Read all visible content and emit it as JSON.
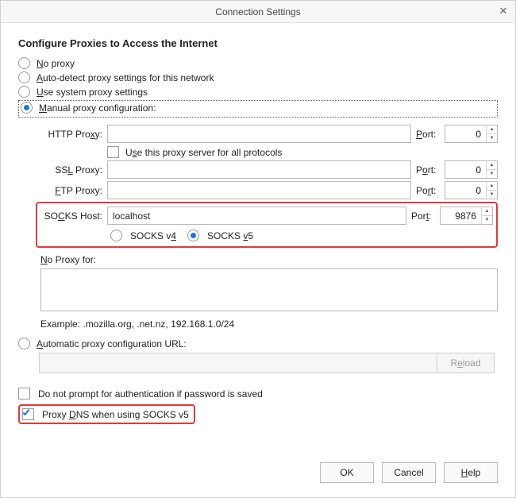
{
  "window": {
    "title": "Connection Settings"
  },
  "heading": "Configure Proxies to Access the Internet",
  "radios": {
    "no_proxy": "No proxy",
    "auto_detect": "Auto-detect proxy settings for this network",
    "system": "Use system proxy settings",
    "manual": "Manual proxy configuration:",
    "pac": "Automatic proxy configuration URL:"
  },
  "labels": {
    "http": "HTTP Proxy:",
    "ssl": "SSL Proxy:",
    "ftp": "FTP Proxy:",
    "socks": "SOCKS Host:",
    "port": "Port:",
    "use_all": "Use this proxy server for all protocols",
    "socks_v4": "SOCKS v4",
    "socks_v5": "SOCKS v5",
    "no_proxy_for": "No Proxy for:",
    "example": "Example: .mozilla.org, .net.nz, 192.168.1.0/24",
    "reload": "Reload",
    "no_prompt": "Do not prompt for authentication if password is saved",
    "proxy_dns": "Proxy DNS when using SOCKS v5"
  },
  "values": {
    "http_host": "",
    "http_port": "0",
    "ssl_host": "",
    "ssl_port": "0",
    "ftp_host": "",
    "ftp_port": "0",
    "socks_host": "localhost",
    "socks_port": "9876",
    "pac_url": ""
  },
  "buttons": {
    "ok": "OK",
    "cancel": "Cancel",
    "help": "Help"
  },
  "underline_map": {
    "no_proxy": "N",
    "auto_detect": "A",
    "system": "U",
    "manual": "M",
    "http": "x",
    "ssl": "L",
    "ftp": "F",
    "socks": "C",
    "port_http": "P",
    "port_ssl": "o",
    "port_ftp": "r",
    "port_socks": "t",
    "use_all": "s",
    "v4": "4",
    "v5": "5",
    "no_proxy_for": "N",
    "pac": "A",
    "reload": "e",
    "proxy_dns": "D",
    "help": "H"
  }
}
